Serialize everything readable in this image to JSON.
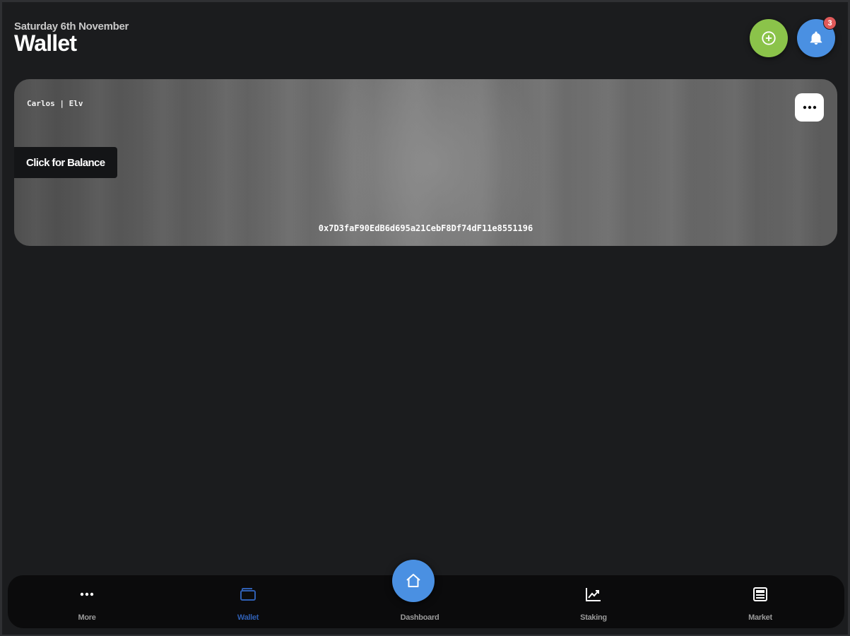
{
  "header": {
    "date": "Saturday 6th November",
    "title": "Wallet",
    "notification_count": "3"
  },
  "card": {
    "owner": "Carlos | Elv",
    "balance_button_label": "Click for Balance",
    "address": "0x7D3faF90EdB6d695a21CebF8Df74dF11e8551196"
  },
  "nav": {
    "items": [
      {
        "label": "More",
        "icon": "more-dots-icon"
      },
      {
        "label": "Wallet",
        "icon": "wallet-icon",
        "active": true
      },
      {
        "label": "Dashboard",
        "icon": "home-icon"
      },
      {
        "label": "Staking",
        "icon": "chart-line-icon"
      },
      {
        "label": "Market",
        "icon": "newspaper-icon"
      }
    ]
  },
  "colors": {
    "add_button": "#8bc34a",
    "bell_button": "#4a90e2",
    "badge": "#e05a5a",
    "active_nav": "#2f5fb3",
    "background": "#1b1c1e"
  }
}
